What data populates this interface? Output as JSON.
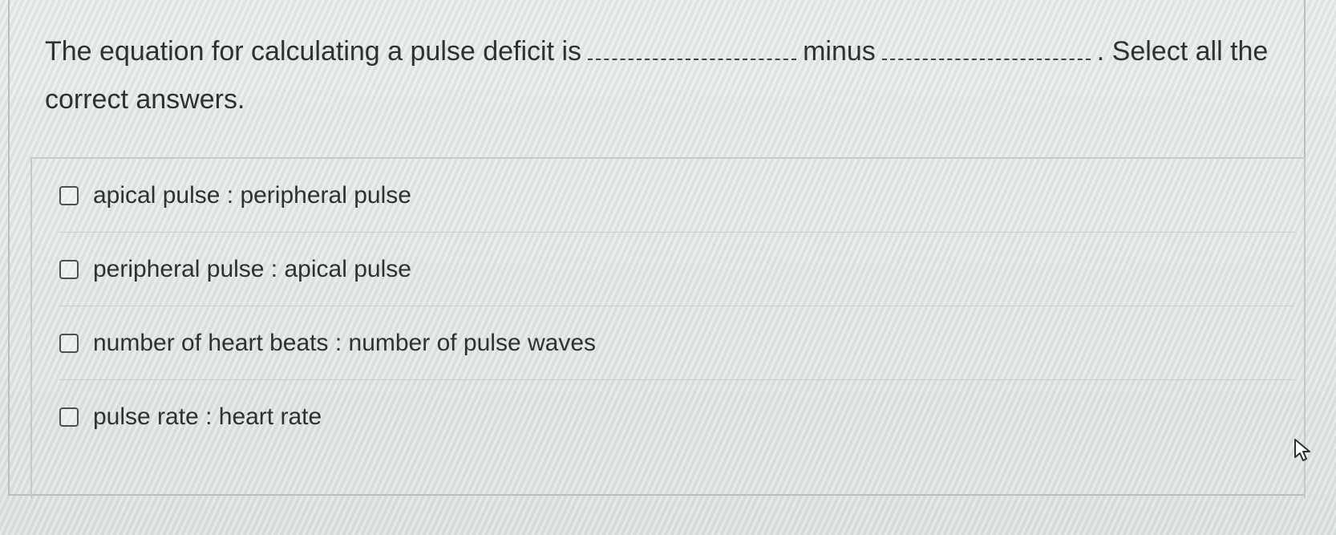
{
  "question": {
    "text_before": "The equation for calculating a pulse deficit is",
    "text_middle": "minus",
    "text_after": ". Select all the correct answers."
  },
  "options": [
    {
      "label": "apical pulse : peripheral pulse",
      "checked": false
    },
    {
      "label": "peripheral pulse : apical pulse",
      "checked": false
    },
    {
      "label": "number of heart beats : number of pulse waves",
      "checked": false
    },
    {
      "label": "pulse rate : heart rate",
      "checked": false
    }
  ],
  "icons": {
    "cursor": "mouse-pointer-icon"
  }
}
